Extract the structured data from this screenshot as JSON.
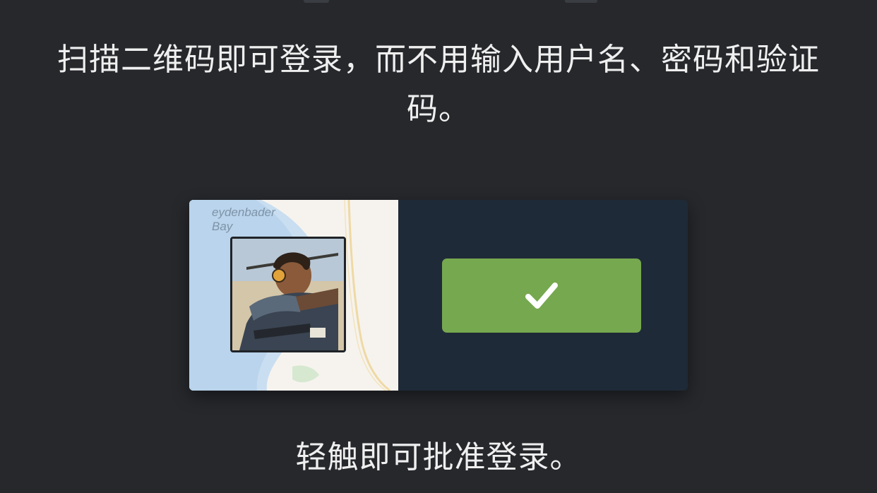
{
  "intro": {
    "message": "扫描二维码即可登录，而不用输入用户名、密码和验证码。"
  },
  "login_card": {
    "map_label": "eydenbader\nBay",
    "avatar_icon": "game-character-avatar",
    "approve_icon": "check-icon",
    "approve_color": "#76a84f"
  },
  "footer": {
    "message": "轻触即可批准登录。"
  }
}
